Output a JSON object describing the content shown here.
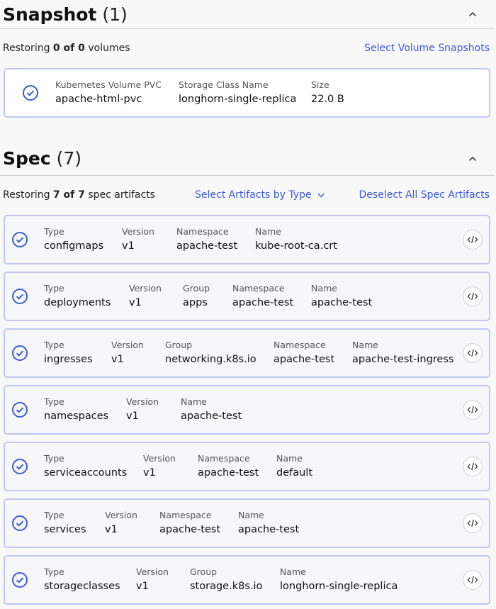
{
  "colors": {
    "accent": "#3d5bd6",
    "card_border": "#c2c7f2",
    "divider": "#cfcfcf"
  },
  "snapshot": {
    "title": "Snapshot",
    "count": "(1)",
    "restoring_prefix": "Restoring",
    "restoring_count": "0 of 0",
    "restoring_suffix": "volumes",
    "select_link": "Select Volume Snapshots",
    "item": {
      "pvc_label": "Kubernetes Volume PVC",
      "pvc_value": "apache-html-pvc",
      "storage_label": "Storage Class Name",
      "storage_value": "longhorn-single-replica",
      "size_label": "Size",
      "size_value": "22.0 B"
    }
  },
  "spec": {
    "title": "Spec",
    "count": "(7)",
    "restoring_prefix": "Restoring",
    "restoring_count": "7 of 7",
    "restoring_suffix": "spec artifacts",
    "select_by_type": "Select Artifacts by Type",
    "deselect_all": "Deselect All Spec Artifacts",
    "items": [
      {
        "type_label": "Type",
        "type": "configmaps",
        "version_label": "Version",
        "version": "v1",
        "namespace_label": "Namespace",
        "namespace": "apache-test",
        "name_label": "Name",
        "name": "kube-root-ca.crt"
      },
      {
        "type_label": "Type",
        "type": "deployments",
        "version_label": "Version",
        "version": "v1",
        "group_label": "Group",
        "group": "apps",
        "namespace_label": "Namespace",
        "namespace": "apache-test",
        "name_label": "Name",
        "name": "apache-test"
      },
      {
        "type_label": "Type",
        "type": "ingresses",
        "version_label": "Version",
        "version": "v1",
        "group_label": "Group",
        "group": "networking.k8s.io",
        "namespace_label": "Namespace",
        "namespace": "apache-test",
        "name_label": "Name",
        "name": "apache-test-ingress"
      },
      {
        "type_label": "Type",
        "type": "namespaces",
        "version_label": "Version",
        "version": "v1",
        "name_label": "Name",
        "name": "apache-test"
      },
      {
        "type_label": "Type",
        "type": "serviceaccounts",
        "version_label": "Version",
        "version": "v1",
        "namespace_label": "Namespace",
        "namespace": "apache-test",
        "name_label": "Name",
        "name": "default"
      },
      {
        "type_label": "Type",
        "type": "services",
        "version_label": "Version",
        "version": "v1",
        "namespace_label": "Namespace",
        "namespace": "apache-test",
        "name_label": "Name",
        "name": "apache-test"
      },
      {
        "type_label": "Type",
        "type": "storageclasses",
        "version_label": "Version",
        "version": "v1",
        "group_label": "Group",
        "group": "storage.k8s.io",
        "name_label": "Name",
        "name": "longhorn-single-replica"
      }
    ]
  }
}
